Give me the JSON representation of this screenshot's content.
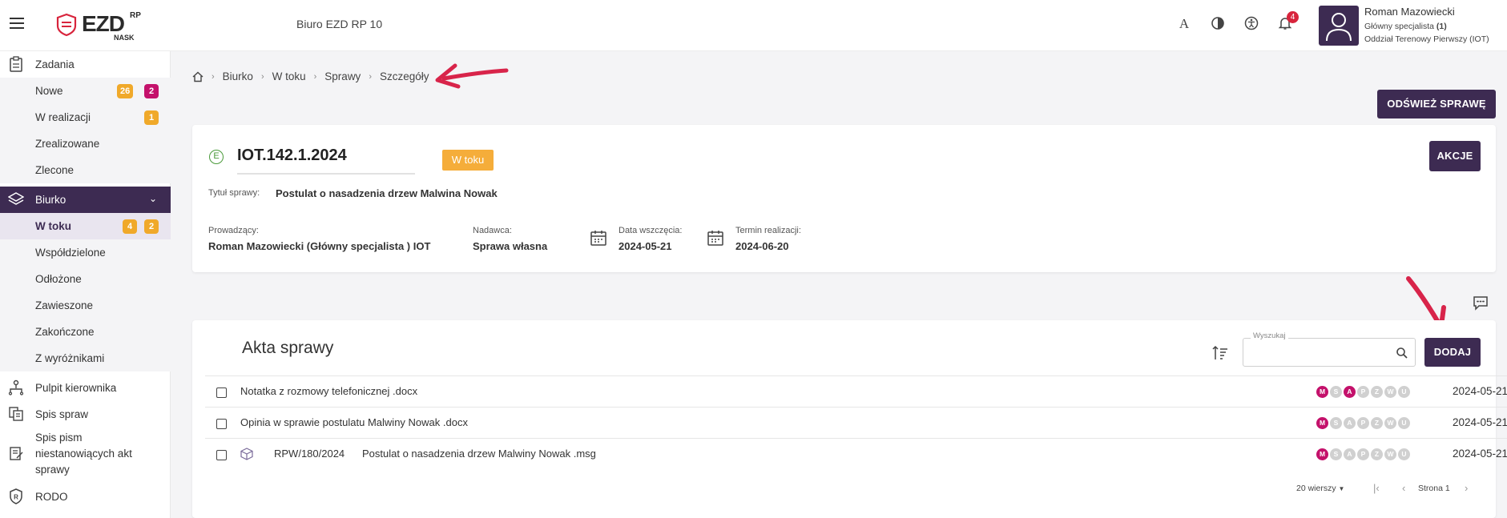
{
  "header": {
    "logo_text": "EZD",
    "logo_sup": "RP",
    "logo_sub": "NASK",
    "app_title": "Biuro EZD RP 10",
    "notification_count": "4",
    "user_name": "Roman Mazowiecki",
    "user_role_text": "Główny specjalista",
    "user_role_count": "(1)",
    "user_department": "Oddział Terenowy Pierwszy (IOT)"
  },
  "sidebar": {
    "zadania": "Zadania",
    "nowe": "Nowe",
    "nowe_badge1": "26",
    "nowe_badge2": "2",
    "w_realizacji": "W realizacji",
    "w_realizacji_badge": "1",
    "zrealizowane": "Zrealizowane",
    "zlecone": "Zlecone",
    "biurko": "Biurko",
    "w_toku": "W toku",
    "w_toku_badge1": "4",
    "w_toku_badge2": "2",
    "wspoldzielone": "Współdzielone",
    "odlozone": "Odłożone",
    "zawieszone": "Zawieszone",
    "zakonczone": "Zakończone",
    "z_wyroznikami": "Z wyróżnikami",
    "pulpit": "Pulpit kierownika",
    "spis_spraw": "Spis spraw",
    "spis_pism": "Spis pism niestanowiących akt sprawy",
    "rodo": "RODO"
  },
  "breadcrumb": [
    "Biurko",
    "W toku",
    "Sprawy",
    "Szczegóły"
  ],
  "refresh_button": "ODŚWIEŻ SPRAWĘ",
  "case": {
    "type_icon_letter": "E",
    "id": "IOT.142.1.2024",
    "status": "W toku",
    "actions_button": "AKCJE",
    "title_label": "Tytuł sprawy:",
    "title_value": "Postulat o nasadzenia drzew Malwina Nowak",
    "lead_label": "Prowadzący:",
    "lead_value": "Roman Mazowiecki (Główny specjalista ) IOT",
    "sender_label": "Nadawca:",
    "sender_value": "Sprawa własna",
    "start_label": "Data wszczęcia:",
    "start_value": "2024-05-21",
    "due_label": "Termin realizacji:",
    "due_value": "2024-06-20"
  },
  "akta": {
    "title": "Akta sprawy",
    "search_label": "Wyszukaj",
    "search_placeholder": "",
    "add_button": "DODAJ",
    "flag_letters": [
      "M",
      "S",
      "A",
      "P",
      "Z",
      "W",
      "U"
    ],
    "rows": [
      {
        "prefix": "",
        "name": "Notatka z rozmowy telefonicznej .docx",
        "date": "2024-05-21",
        "active_flags": [
          "M",
          "A"
        ]
      },
      {
        "prefix": "",
        "name": "Opinia w sprawie postulatu Malwiny Nowak .docx",
        "date": "2024-05-21",
        "active_flags": [
          "M"
        ]
      },
      {
        "prefix": "RPW/180/2024",
        "name": "Postulat o nasadzenia drzew Malwiny Nowak .msg",
        "date": "2024-05-21",
        "active_flags": [
          "M"
        ]
      }
    ],
    "rows_per_page": "20 wierszy",
    "page_label": "Strona 1"
  },
  "colors": {
    "brand": "#3d2b52",
    "badge_orange": "#f0a92a",
    "badge_pink": "#c4116b",
    "status_chip": "#f5ad3a",
    "annotation_arrow": "#d8244a"
  }
}
